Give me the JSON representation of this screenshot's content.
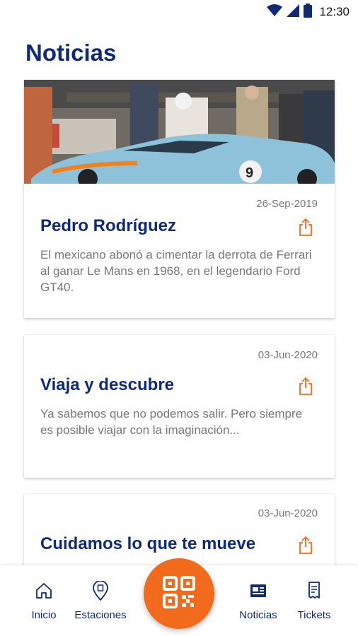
{
  "status_bar": {
    "time": "12:30"
  },
  "page": {
    "title": "Noticias"
  },
  "news": [
    {
      "date": "26-Sep-2019",
      "title": "Pedro Rodríguez",
      "text": "El mexicano abonó a cimentar la derrota de Ferrari al ganar Le Mans en 1968, en el legendario Ford GT40."
    },
    {
      "date": "03-Jun-2020",
      "title": "Viaja y descubre",
      "text": "Ya sabemos que no podemos salir. Pero siempre es posible viajar con la imaginación..."
    },
    {
      "date": "03-Jun-2020",
      "title": "Cuidamos lo que te mueve",
      "text": ""
    }
  ],
  "bottom_nav": {
    "items": [
      {
        "label": "Inicio",
        "icon": "home-icon"
      },
      {
        "label": "Estaciones",
        "icon": "location-pin-icon"
      },
      {
        "label": "Noticias",
        "icon": "newspaper-icon"
      },
      {
        "label": "Tickets",
        "icon": "receipt-icon"
      }
    ],
    "center_button_icon": "qr-code-icon"
  },
  "colors": {
    "brand_navy": "#0e2a78",
    "accent_orange": "#f26a1b",
    "body_text": "#777777",
    "nav_icon": "#0e2a78"
  }
}
